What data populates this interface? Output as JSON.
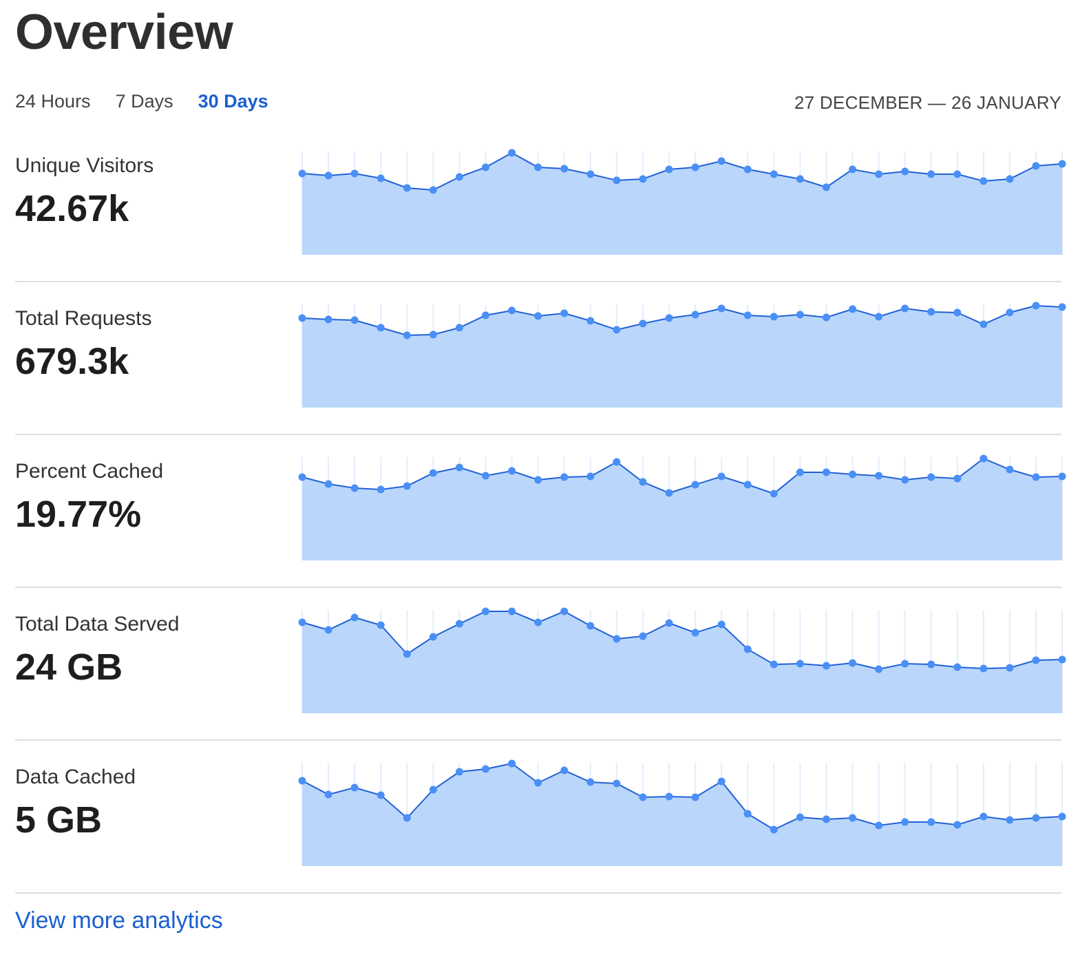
{
  "header": {
    "title": "Overview"
  },
  "tabs": [
    {
      "label": "24 Hours",
      "active": false
    },
    {
      "label": "7 Days",
      "active": false
    },
    {
      "label": "30 Days",
      "active": true
    }
  ],
  "date_range": "27 DECEMBER — 26 JANUARY",
  "colors": {
    "accent": "#1a5fd0",
    "line": "#2060d6",
    "dot": "#4a8ff5",
    "fill": "#bad7fb",
    "grid": "#e3eefc"
  },
  "metrics": [
    {
      "label": "Unique Visitors",
      "value": "42.67k"
    },
    {
      "label": "Total Requests",
      "value": "679.3k"
    },
    {
      "label": "Percent Cached",
      "value": "19.77%"
    },
    {
      "label": "Total Data Served",
      "value": "24 GB"
    },
    {
      "label": "Data Cached",
      "value": "5 GB"
    }
  ],
  "chart_data": [
    {
      "type": "area",
      "values": [
        118,
        115,
        118,
        111,
        97,
        94,
        113,
        127,
        148,
        127,
        125,
        117,
        108,
        110,
        124,
        127,
        136,
        124,
        117,
        110,
        98,
        124,
        117,
        121,
        117,
        117,
        107,
        110,
        129,
        132
      ]
    },
    {
      "type": "area",
      "values": [
        130,
        128,
        127,
        116,
        105,
        106,
        116,
        134,
        141,
        133,
        137,
        126,
        113,
        122,
        130,
        135,
        144,
        134,
        132,
        135,
        131,
        143,
        132,
        144,
        139,
        138,
        121,
        138,
        148,
        146
      ]
    },
    {
      "type": "area",
      "values": [
        121,
        111,
        105,
        103,
        108,
        127,
        135,
        123,
        130,
        117,
        121,
        122,
        143,
        114,
        98,
        110,
        122,
        110,
        97,
        128,
        128,
        125,
        123,
        117,
        121,
        119,
        148,
        132,
        121,
        122
      ]
    },
    {
      "type": "area",
      "values": [
        132,
        121,
        139,
        128,
        86,
        111,
        130,
        148,
        148,
        132,
        148,
        127,
        108,
        112,
        131,
        117,
        129,
        93,
        71,
        72,
        69,
        73,
        64,
        72,
        71,
        67,
        65,
        66,
        77,
        78
      ]
    },
    {
      "type": "area",
      "values": [
        124,
        104,
        114,
        103,
        70,
        111,
        137,
        141,
        149,
        121,
        139,
        122,
        120,
        100,
        101,
        100,
        123,
        76,
        53,
        71,
        68,
        70,
        59,
        64,
        64,
        60,
        72,
        67,
        70,
        72
      ]
    }
  ],
  "footer": {
    "link_label": "View more analytics"
  }
}
